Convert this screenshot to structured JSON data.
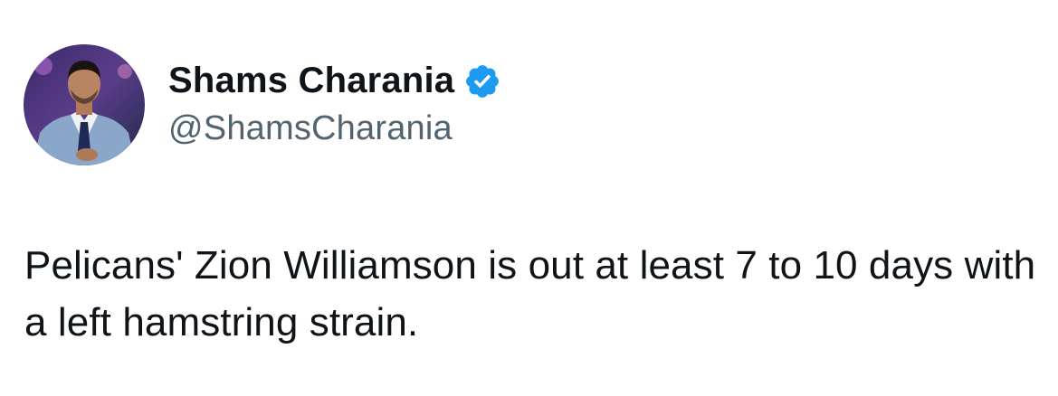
{
  "author": {
    "display_name": "Shams Charania",
    "handle": "@ShamsCharania",
    "verified": true,
    "verified_icon": "verified-badge-icon",
    "avatar_icon": "profile-photo"
  },
  "tweet": {
    "text": "Pelicans' Zion Williamson is out at least 7 to 10 days with a left hamstring strain."
  },
  "colors": {
    "text_primary": "#0f1419",
    "text_secondary": "#536471",
    "verified_blue": "#1d9bf0",
    "background": "#ffffff"
  }
}
